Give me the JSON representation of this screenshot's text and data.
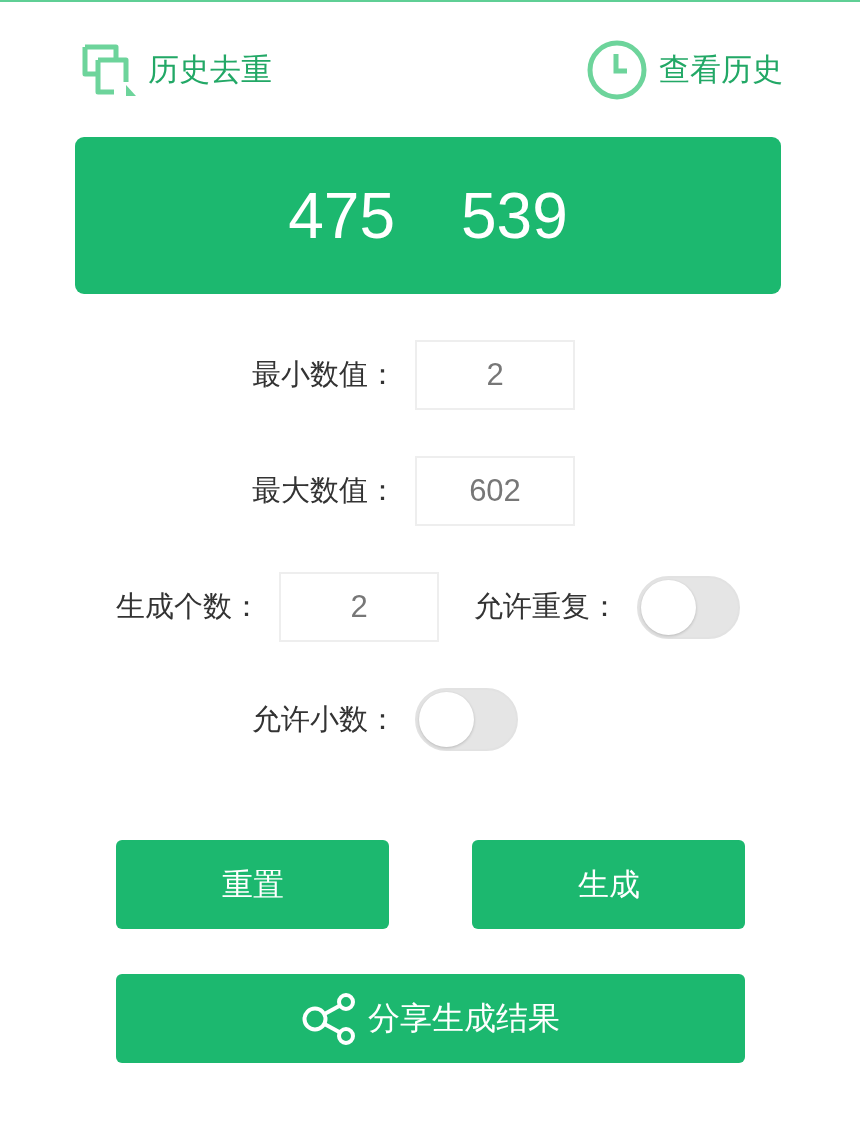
{
  "header": {
    "links": [
      {
        "kind": "dedupe",
        "label": "历史去重"
      },
      {
        "kind": "history",
        "label": "查看历史"
      }
    ]
  },
  "result": {
    "numbers": [
      "475",
      "539"
    ]
  },
  "settings": {
    "rows": [
      {
        "fields": [
          {
            "kind": "number",
            "label": "最小数值：",
            "value": "2"
          }
        ]
      },
      {
        "fields": [
          {
            "kind": "number",
            "label": "最大数值：",
            "value": "602"
          }
        ]
      },
      {
        "fields": [
          {
            "kind": "number",
            "label": "生成个数：",
            "value": "2"
          },
          {
            "kind": "toggle",
            "label": "允许重复：",
            "on": false
          }
        ]
      },
      {
        "fields": [
          {
            "kind": "toggle",
            "label": "允许小数：",
            "on": false
          }
        ]
      }
    ]
  },
  "actions": {
    "buttons": [
      "重置",
      "生成"
    ],
    "share": {
      "label": "分享生成结果"
    }
  }
}
